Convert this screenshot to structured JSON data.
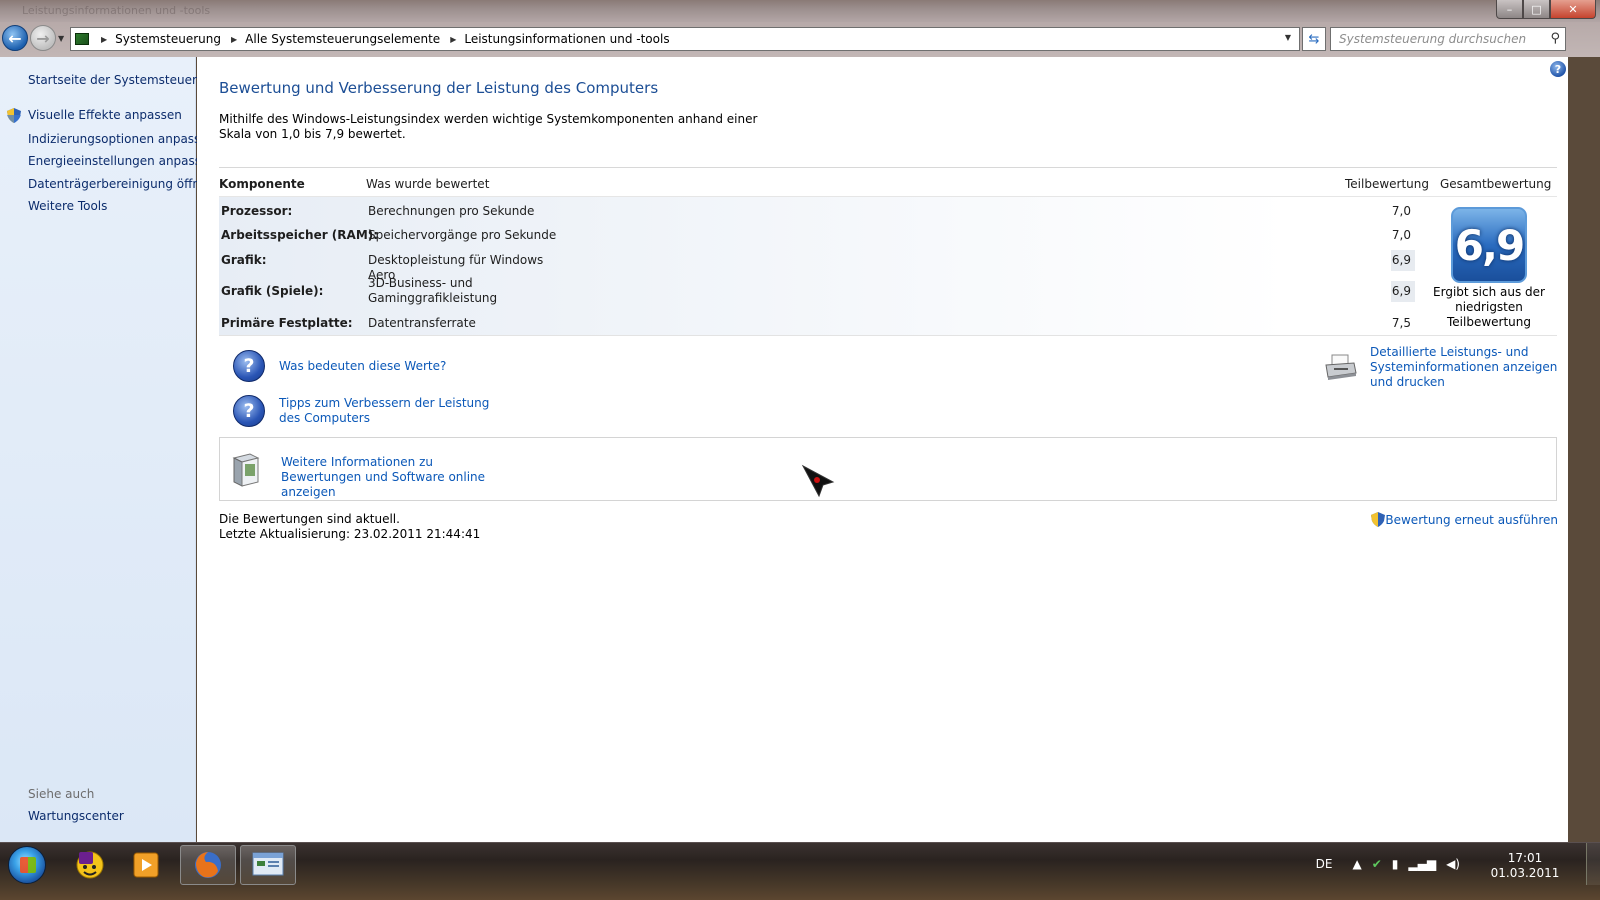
{
  "window": {
    "title": "Leistungsinformationen und -tools",
    "buttons": {
      "minimize": "–",
      "maximize": "□",
      "close": "✕"
    }
  },
  "address": {
    "breadcrumbs": [
      "Systemsteuerung",
      "Alle Systemsteuerungselemente",
      "Leistungsinformationen und -tools"
    ],
    "search_placeholder": "Systemsteuerung durchsuchen"
  },
  "sidebar": {
    "home": "Startseite der Systemsteuerung",
    "items": [
      {
        "label": "Visuelle Effekte anpassen",
        "shield": true
      },
      {
        "label": "Indizierungsoptionen anpassen",
        "shield": false
      },
      {
        "label": "Energieeinstellungen anpassen",
        "shield": false
      },
      {
        "label": "Datenträgerbereinigung öffnen",
        "shield": false
      },
      {
        "label": "Weitere Tools",
        "shield": false
      }
    ],
    "see_also_label": "Siehe auch",
    "see_also": [
      "Wartungscenter"
    ]
  },
  "main": {
    "title": "Bewertung und Verbesserung der Leistung des Computers",
    "intro": "Mithilfe des Windows-Leistungsindex werden wichtige Systemkomponenten anhand einer Skala von 1,0 bis 7,9 bewertet.",
    "table": {
      "headers": {
        "component": "Komponente",
        "rated": "Was wurde bewertet",
        "subscore": "Teilbewertung",
        "basescore": "Gesamtbewertung"
      },
      "rows": [
        {
          "component": "Prozessor:",
          "rated": "Berechnungen pro Sekunde",
          "score": "7,0",
          "lowest": false
        },
        {
          "component": "Arbeitsspeicher (RAM):",
          "rated": "Speichervorgänge pro Sekunde",
          "score": "7,0",
          "lowest": false
        },
        {
          "component": "Grafik:",
          "rated": "Desktopleistung für Windows Aero",
          "score": "6,9",
          "lowest": true
        },
        {
          "component": "Grafik (Spiele):",
          "rated": "3D-Business- und Gaminggrafikleistung",
          "score": "6,9",
          "lowest": true
        },
        {
          "component": "Primäre Festplatte:",
          "rated": "Datentransferrate",
          "score": "7,5",
          "lowest": false
        }
      ],
      "base_score": "6,9",
      "base_caption": "Ergibt sich aus der niedrigsten Teilbewertung"
    },
    "links": {
      "what_mean": "Was bedeuten diese Werte?",
      "tips": "Tipps zum Verbessern der Leistung des Computers",
      "detailed": "Detaillierte Leistungs- und Systeminformationen anzeigen und drucken",
      "online": "Weitere Informationen zu Bewertungen und Software online anzeigen"
    },
    "status": {
      "current": "Die Bewertungen sind aktuell.",
      "last_update": "Letzte Aktualisierung: 23.02.2011 21:44:41"
    },
    "rerun": "Bewertung erneut ausführen"
  },
  "taskbar": {
    "apps": [
      "windows-explorer",
      "yahoo-messenger",
      "media-player",
      "firefox",
      "control-panel"
    ],
    "language": "DE",
    "time": "17:01",
    "date": "01.03.2011"
  },
  "colors": {
    "link": "#0b58b8",
    "title": "#1c4e95",
    "sidebar_bg": "#e8f0fa",
    "score_tile": "#2a6cc0"
  }
}
